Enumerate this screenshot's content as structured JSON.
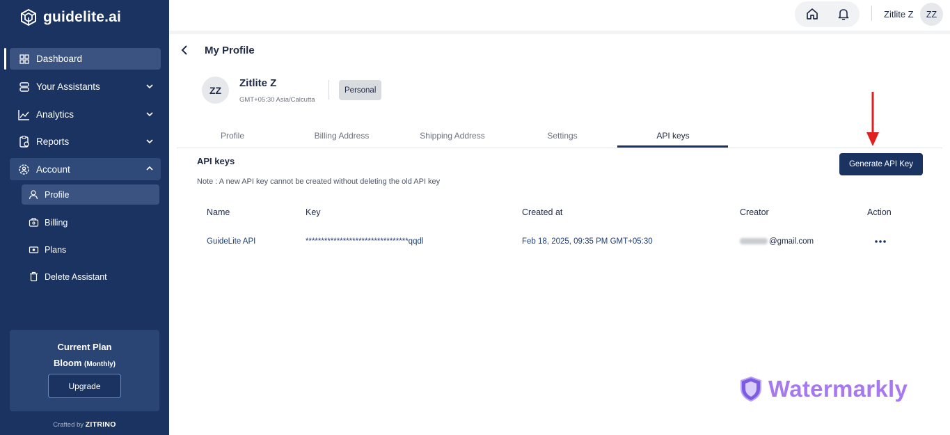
{
  "brand": {
    "name": "guidelite.ai"
  },
  "sidebar": {
    "items": [
      {
        "label": "Dashboard",
        "icon": "dashboard-icon"
      },
      {
        "label": "Your Assistants",
        "icon": "assistants-icon"
      },
      {
        "label": "Analytics",
        "icon": "analytics-icon"
      },
      {
        "label": "Reports",
        "icon": "reports-icon"
      },
      {
        "label": "Account",
        "icon": "account-icon"
      }
    ],
    "account_sub": [
      {
        "label": "Profile",
        "icon": "profile-icon"
      },
      {
        "label": "Billing",
        "icon": "billing-icon"
      },
      {
        "label": "Plans",
        "icon": "plans-icon"
      },
      {
        "label": "Delete Assistant",
        "icon": "trash-icon"
      }
    ],
    "plan": {
      "title": "Current Plan",
      "name": "Bloom",
      "cycle": "(Monthly)",
      "upgrade_label": "Upgrade"
    },
    "crafted_prefix": "Crafted by",
    "crafted_brand": "ZITRINO"
  },
  "header": {
    "user_name": "Zitlite Z",
    "user_initials": "ZZ"
  },
  "page": {
    "title": "My Profile",
    "profile": {
      "initials": "ZZ",
      "name": "Zitlite Z",
      "timezone": "GMT+05:30 Asia/Calcutta",
      "badge": "Personal"
    },
    "tabs": [
      {
        "label": "Profile"
      },
      {
        "label": "Billing Address"
      },
      {
        "label": "Shipping Address"
      },
      {
        "label": "Settings"
      },
      {
        "label": "API keys",
        "active": true
      }
    ],
    "api": {
      "section_title": "API keys",
      "note": "Note : A new API key cannot be created without deleting the old API key",
      "generate_label": "Generate API Key",
      "columns": [
        "Name",
        "Key",
        "Created at",
        "Creator",
        "Action"
      ],
      "rows": [
        {
          "name": "GuideLite API",
          "key": "*********************************qqdl",
          "created_at": "Feb 18, 2025, 09:35 PM GMT+05:30",
          "creator": "@gmail.com"
        }
      ]
    }
  },
  "watermark": {
    "text": "Watermarkly"
  },
  "colors": {
    "sidebar_bg": "#1b3360",
    "accent": "#1b3360",
    "arrow": "#e02020",
    "watermark": "#a679f0"
  }
}
